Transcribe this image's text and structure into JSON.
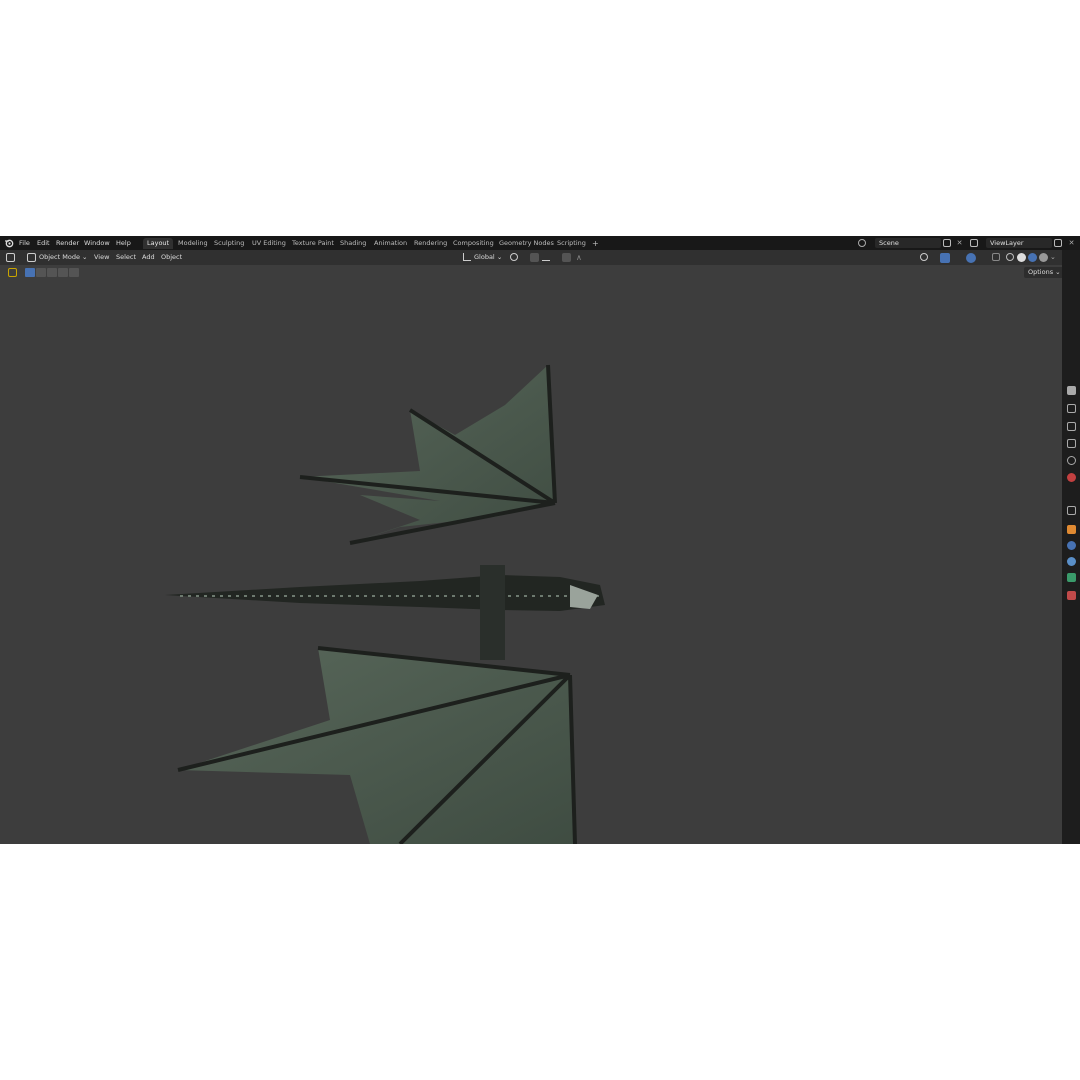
{
  "menu": {
    "items": [
      "File",
      "Edit",
      "Render",
      "Window",
      "Help"
    ]
  },
  "workspaces": {
    "tabs": [
      "Layout",
      "Modeling",
      "Sculpting",
      "UV Editing",
      "Texture Paint",
      "Shading",
      "Animation",
      "Rendering",
      "Compositing",
      "Geometry Nodes",
      "Scripting"
    ],
    "add_label": "+",
    "active": "Layout"
  },
  "scene": {
    "name": "Scene"
  },
  "view_layer": {
    "name": "ViewLayer"
  },
  "header": {
    "mode": "Object Mode",
    "menus": [
      "View",
      "Select",
      "Add",
      "Object"
    ],
    "transform_orientation": "Global",
    "options_label": "Options"
  },
  "colors": {
    "topbar": "#181818",
    "header": "#303030",
    "viewport": "#3d3d3d",
    "accent": "#4772b3"
  },
  "icons": {
    "properties_tabs": [
      "tool-icon",
      "render-icon",
      "output-icon",
      "view-layer-icon",
      "scene-icon",
      "world-icon",
      "collection-icon",
      "object-icon",
      "modifier-icon",
      "particles-icon",
      "physics-icon",
      "constraints-icon",
      "data-icon",
      "material-icon"
    ]
  }
}
